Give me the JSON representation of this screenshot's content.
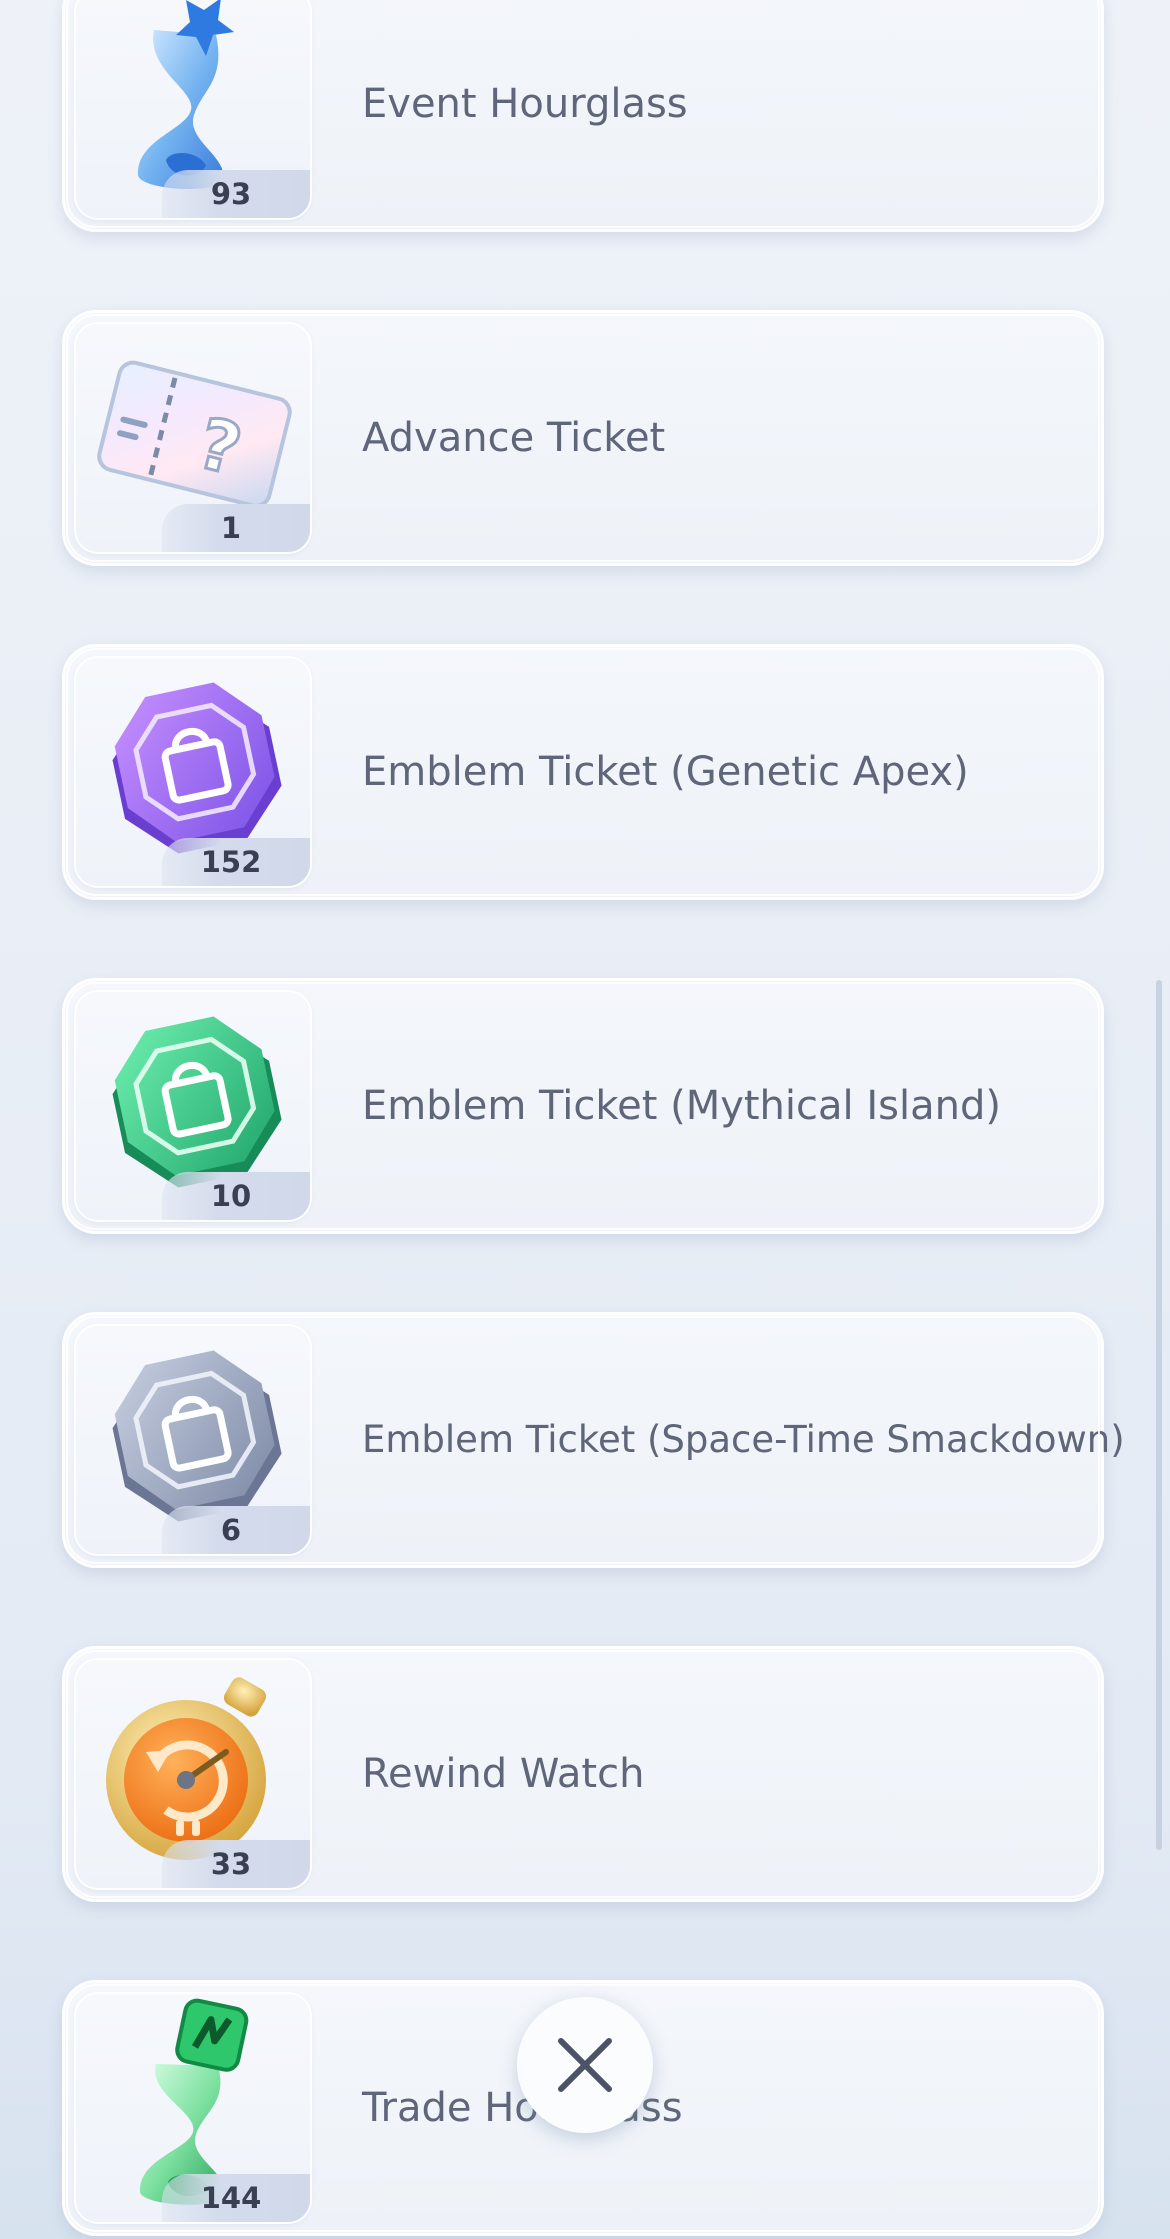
{
  "items": [
    {
      "name": "Event Hourglass",
      "count": "93",
      "icon": "event-hourglass-icon"
    },
    {
      "name": "Advance Ticket",
      "count": "1",
      "icon": "advance-ticket-icon"
    },
    {
      "name": "Emblem Ticket (Genetic Apex)",
      "count": "152",
      "icon": "emblem-ticket-purple-icon"
    },
    {
      "name": "Emblem Ticket (Mythical Island)",
      "count": "10",
      "icon": "emblem-ticket-green-icon"
    },
    {
      "name": "Emblem Ticket (Space-Time Smackdown)",
      "count": "6",
      "icon": "emblem-ticket-gray-icon"
    },
    {
      "name": "Rewind Watch",
      "count": "33",
      "icon": "rewind-watch-icon"
    },
    {
      "name": "Trade Hourglass",
      "count": "144",
      "icon": "trade-hourglass-icon"
    }
  ],
  "close_button": {
    "icon": "close-icon"
  },
  "colors": {
    "background": "#eaeff6",
    "card": "#f2f5fa",
    "text": "#5f6679",
    "count_text": "#3a3f54"
  }
}
